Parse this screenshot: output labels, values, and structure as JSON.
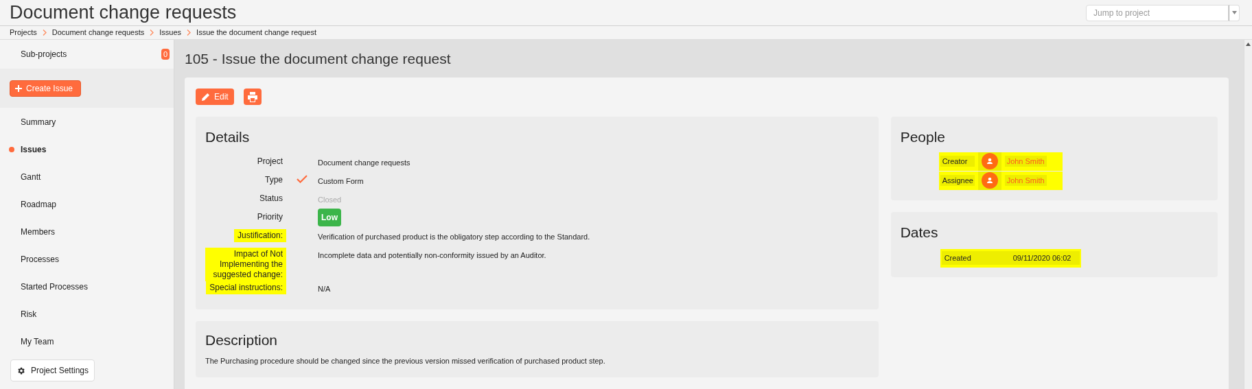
{
  "header": {
    "title": "Document change requests",
    "jump_to_project": {
      "placeholder": "Jump to project"
    }
  },
  "breadcrumbs": [
    "Projects",
    "Document change requests",
    "Issues",
    "Issue the document change request"
  ],
  "sidebar": {
    "sub_projects": {
      "label": "Sub-projects",
      "count": "0"
    },
    "create_button": "Create Issue",
    "items": [
      {
        "label": "Summary",
        "selected": false
      },
      {
        "label": "Issues",
        "selected": true
      },
      {
        "label": "Gantt",
        "selected": false
      },
      {
        "label": "Roadmap",
        "selected": false
      },
      {
        "label": "Members",
        "selected": false
      },
      {
        "label": "Processes",
        "selected": false
      },
      {
        "label": "Started Processes",
        "selected": false
      },
      {
        "label": "Risk",
        "selected": false
      },
      {
        "label": "My Team",
        "selected": false
      }
    ],
    "settings_button": "Project Settings"
  },
  "issue": {
    "title": "105 - Issue the document change request",
    "edit_button": "Edit"
  },
  "details": {
    "title": "Details",
    "fields": [
      {
        "label": "Project",
        "value": "Document change requests",
        "kind": "plain",
        "highlighted": false
      },
      {
        "label": "Type",
        "value": "Custom Form",
        "kind": "checked",
        "highlighted": false
      },
      {
        "label": "Status",
        "value": "Closed",
        "kind": "muted",
        "highlighted": false
      },
      {
        "label": "Priority",
        "value": "Low",
        "kind": "badge",
        "highlighted": false
      },
      {
        "label": "Justification:",
        "value": "Verification of purchased product is the obligatory step according to the Standard.",
        "kind": "plain",
        "highlighted": true
      },
      {
        "label": "Impact of Not Implementing the suggested change:",
        "value": "Incomplete data and potentially non-conformity issued by an Auditor.",
        "kind": "plain",
        "highlighted": true
      },
      {
        "label": "Special instructions:",
        "value": "N/A",
        "kind": "plain",
        "highlighted": true
      }
    ]
  },
  "people": {
    "title": "People",
    "rows": [
      {
        "role": "Creator",
        "name": "John Smith",
        "highlighted": true
      },
      {
        "role": "Assignee",
        "name": "John Smith",
        "highlighted": true
      }
    ]
  },
  "dates": {
    "title": "Dates",
    "rows": [
      {
        "label": "Created",
        "value": "09/11/2020 06:02",
        "highlighted": true
      }
    ]
  },
  "description": {
    "title": "Description",
    "text": "The Purchasing procedure should be changed since the previous version missed verification of purchased product step."
  }
}
